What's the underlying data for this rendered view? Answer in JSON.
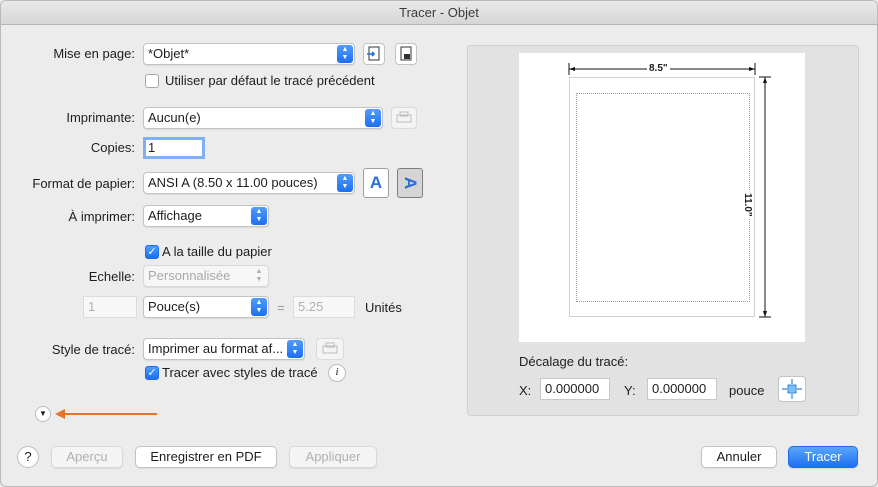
{
  "window": {
    "title": "Tracer - Objet"
  },
  "page_setup": {
    "label": "Mise en page:",
    "value": "*Objet*",
    "use_default_label": "Utiliser par défaut le tracé précédent",
    "use_default_checked": false
  },
  "printer": {
    "label": "Imprimante:",
    "value": "Aucun(e)"
  },
  "copies": {
    "label": "Copies:",
    "value": "1"
  },
  "paper_size": {
    "label": "Format de papier:",
    "value": "ANSI A (8.50 x 11.00 pouces)",
    "portrait_glyph": "A",
    "landscape_glyph": "A"
  },
  "plot_area": {
    "label": "À imprimer:",
    "value": "Affichage"
  },
  "fit_to_paper": {
    "label": "A la taille du papier",
    "checked": true
  },
  "scale": {
    "label": "Echelle:",
    "value": "Personnalisée",
    "left_value": "1",
    "unit_value": "Pouce(s)",
    "equals": "=",
    "right_value": "5.25",
    "units_label": "Unités"
  },
  "plot_style": {
    "label": "Style de tracé:",
    "value": "Imprimer au format af...",
    "with_styles_label": "Tracer avec styles de tracé",
    "with_styles_checked": true,
    "info_glyph": "i"
  },
  "preview": {
    "width_label": "8.5\"",
    "height_label": "11.0\"",
    "offset_title": "Décalage du tracé:",
    "x_label": "X:",
    "x_value": "0.000000",
    "y_label": "Y:",
    "y_value": "0.000000",
    "unit": "pouce"
  },
  "buttons": {
    "help": "?",
    "preview": "Aperçu",
    "save_pdf": "Enregistrer en PDF",
    "apply": "Appliquer",
    "cancel": "Annuler",
    "plot": "Tracer"
  },
  "colors": {
    "accent": "#1d6ff2",
    "annotation_arrow": "#e8732c"
  },
  "icons": {
    "import_page_setup": "import-icon",
    "page_setup_manager": "page-setup-icon",
    "printer_properties": "printer-properties-icon",
    "plot_style_edit": "plot-style-edit-icon",
    "expand": "disclosure-chevron-icon",
    "center_plot": "center-plot-icon"
  }
}
